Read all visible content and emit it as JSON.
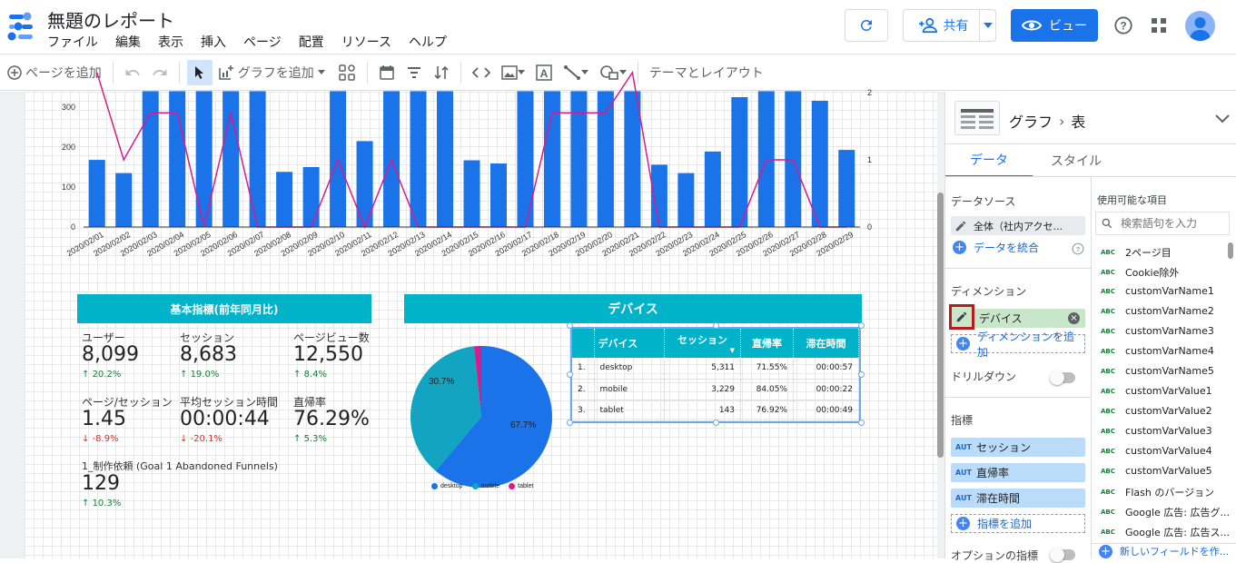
{
  "app": {
    "title": "無題のレポート",
    "menu": [
      "ファイル",
      "編集",
      "表示",
      "挿入",
      "ページ",
      "配置",
      "リソース",
      "ヘルプ"
    ],
    "share_label": "共有",
    "view_label": "ビュー"
  },
  "toolbar": {
    "add_page": "ページを追加",
    "add_chart": "グラフを追加",
    "theme_layout": "テーマとレイアウト"
  },
  "combo_chart": {
    "y_ticks": [
      "0",
      "100",
      "200",
      "300"
    ],
    "y2_ticks": [
      "0",
      "1",
      "2"
    ]
  },
  "scorecards": {
    "header": "基本指標(前年同月比)",
    "metrics": [
      {
        "label": "ユーザー",
        "value": "8,099",
        "delta": "20.2%",
        "dir": "up"
      },
      {
        "label": "セッション",
        "value": "8,683",
        "delta": "19.0%",
        "dir": "up"
      },
      {
        "label": "ページビュー数",
        "value": "12,550",
        "delta": "8.4%",
        "dir": "up"
      },
      {
        "label": "ページ/セッション",
        "value": "1.45",
        "delta": "-8.9%",
        "dir": "down"
      },
      {
        "label": "平均セッション時間",
        "value": "00:00:44",
        "delta": "-20.1%",
        "dir": "down"
      },
      {
        "label": "直帰率",
        "value": "76.29%",
        "delta": "5.3%",
        "dir": "up"
      },
      {
        "label": "1_制作依頼 (Goal 1 Abandoned Funnels)",
        "value": "129",
        "delta": "10.3%",
        "dir": "up"
      }
    ]
  },
  "device_section": {
    "header": "デバイス",
    "pie_labels": {
      "desktop": "67.7%",
      "mobile": "30.7%"
    },
    "legend": [
      "desktop",
      "mobile",
      "tablet"
    ],
    "colors": {
      "desktop": "#1a73e8",
      "mobile": "#12a4c1",
      "tablet": "#d81b8c"
    },
    "table": {
      "headers": [
        "デバイス",
        "セッション",
        "直帰率",
        "滞在時間"
      ],
      "rows": [
        {
          "idx": "1.",
          "device": "desktop",
          "sessions": "5,311",
          "bounce": "71.55%",
          "time": "00:00:57"
        },
        {
          "idx": "2.",
          "device": "mobile",
          "sessions": "3,229",
          "bounce": "84.05%",
          "time": "00:00:22"
        },
        {
          "idx": "3.",
          "device": "tablet",
          "sessions": "143",
          "bounce": "76.92%",
          "time": "00:00:49"
        }
      ]
    }
  },
  "chart_data": {
    "type": "bar",
    "categories": [
      "2020/02/01",
      "2020/02/02",
      "2020/02/03",
      "2020/02/04",
      "2020/02/05",
      "2020/02/06",
      "2020/02/07",
      "2020/02/08",
      "2020/02/09",
      "2020/02/10",
      "2020/02/11",
      "2020/02/12",
      "2020/02/13",
      "2020/02/14",
      "2020/02/15",
      "2020/02/16",
      "2020/02/17",
      "2020/02/18",
      "2020/02/19",
      "2020/02/20",
      "2020/02/21",
      "2020/02/22",
      "2020/02/23",
      "2020/02/24",
      "2020/02/25",
      "2020/02/26",
      "2020/02/27",
      "2020/02/28",
      "2020/02/29"
    ],
    "series": [
      {
        "values": [
          168,
          135,
          340,
          340,
          340,
          340,
          340,
          138,
          150,
          340,
          215,
          340,
          340,
          340,
          167,
          159,
          340,
          340,
          340,
          340,
          340,
          156,
          135,
          189,
          325,
          340,
          340,
          316,
          193
        ]
      },
      {
        "type": "line",
        "axis": "right",
        "values": [
          2.3,
          1,
          1.7,
          1.7,
          0,
          1.7,
          0,
          0,
          0,
          1,
          0,
          1,
          0,
          0,
          0,
          0,
          0,
          1.7,
          1.7,
          1.7,
          2.3,
          0,
          0,
          0,
          0,
          1,
          1,
          0,
          0
        ]
      }
    ],
    "ylim": [
      0,
      300
    ],
    "y2lim": [
      0,
      2
    ]
  },
  "panel": {
    "breadcrumb_a": "グラフ",
    "breadcrumb_b": "表",
    "tab_data": "データ",
    "tab_style": "スタイル",
    "datasource_label": "データソース",
    "datasource_value": "全体（社内アクセ...",
    "blend_label": "データを統合",
    "dimension_label": "ディメンション",
    "dimension_value": "デバイス",
    "add_dimension": "ディメンションを追加",
    "drilldown": "ドリルダウン",
    "metrics_label": "指標",
    "metrics": [
      "セッション",
      "直帰率",
      "滞在時間"
    ],
    "add_metric": "指標を追加",
    "optional_metrics": "オプションの指標",
    "available_fields_label": "使用可能な項目",
    "search_placeholder": "検索語句を入力",
    "fields": [
      "2ページ目",
      "Cookie除外",
      "customVarName1",
      "customVarName2",
      "customVarName3",
      "customVarName4",
      "customVarName5",
      "customVarValue1",
      "customVarValue2",
      "customVarValue3",
      "customVarValue4",
      "customVarValue5",
      "Flash のバージョン",
      "Google 広告: 広告グ...",
      "Google 広告: 広告ス..."
    ],
    "new_field": "新しいフィールドを作..."
  }
}
